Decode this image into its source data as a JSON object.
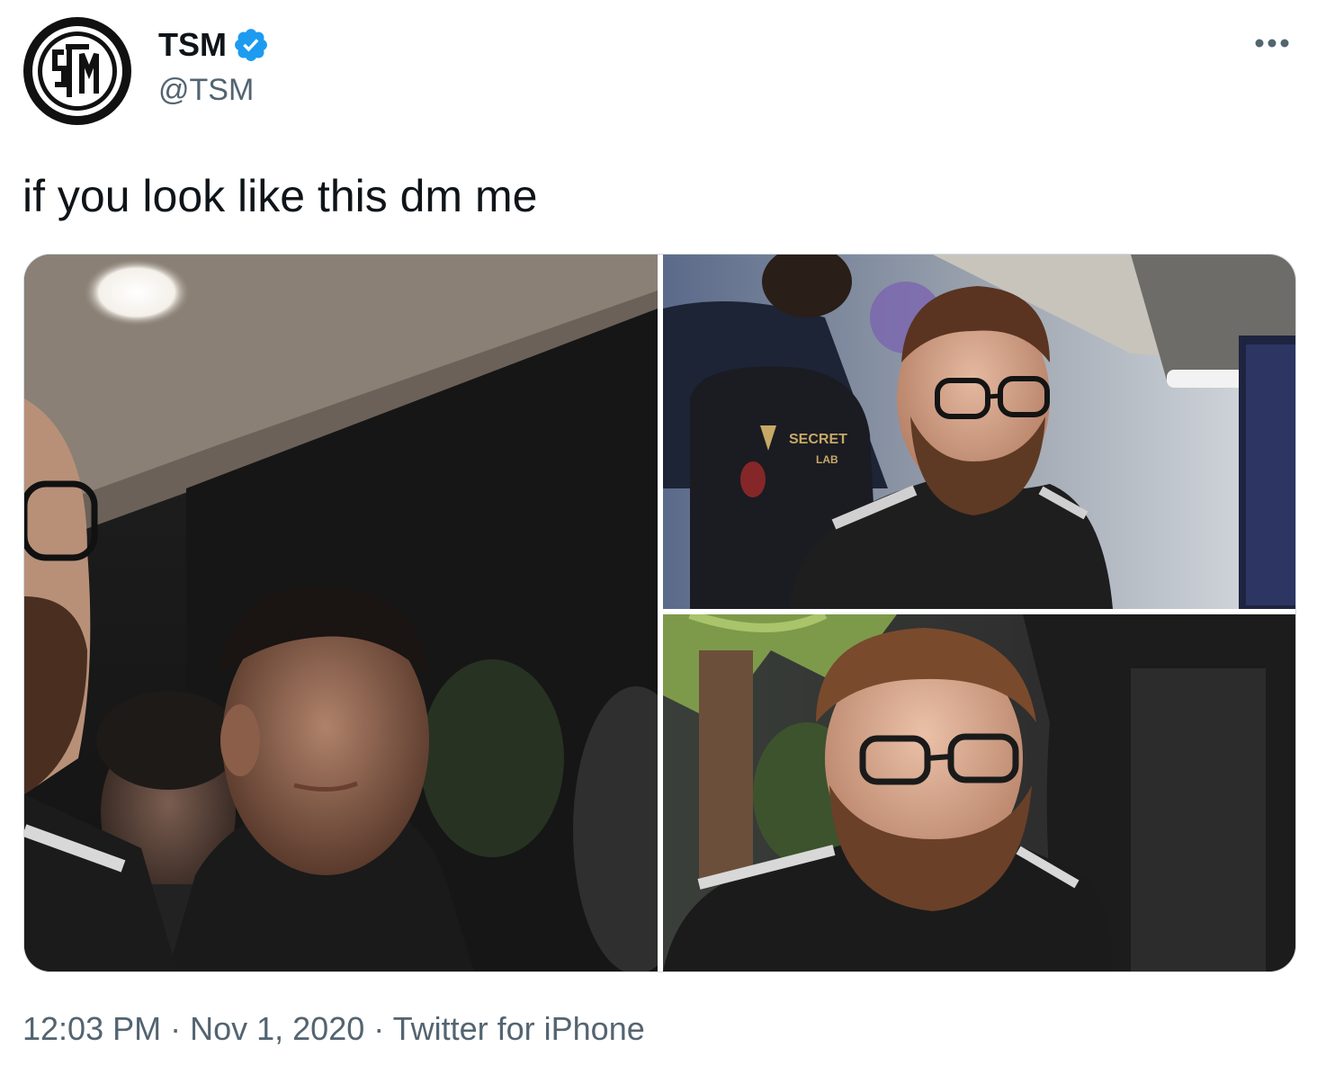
{
  "author": {
    "display_name": "TSM",
    "handle": "@TSM",
    "verified": true,
    "avatar_icon": "tsm-logo-icon",
    "verified_icon": "verified-badge-icon",
    "verified_color": "#1d9bf0"
  },
  "more_icon": "more-options-icon",
  "tweet": {
    "text": "if you look like this dm me"
  },
  "media": {
    "photo_count": 3,
    "photo_2_chair_text_line1": "SECRET",
    "photo_2_chair_text_line2": "LAB"
  },
  "meta": {
    "time": "12:03 PM",
    "separator": "·",
    "date": "Nov 1, 2020",
    "source": "Twitter for iPhone"
  },
  "colors": {
    "text_primary": "#0f1419",
    "text_secondary": "#536471",
    "border": "#cfd9de"
  }
}
